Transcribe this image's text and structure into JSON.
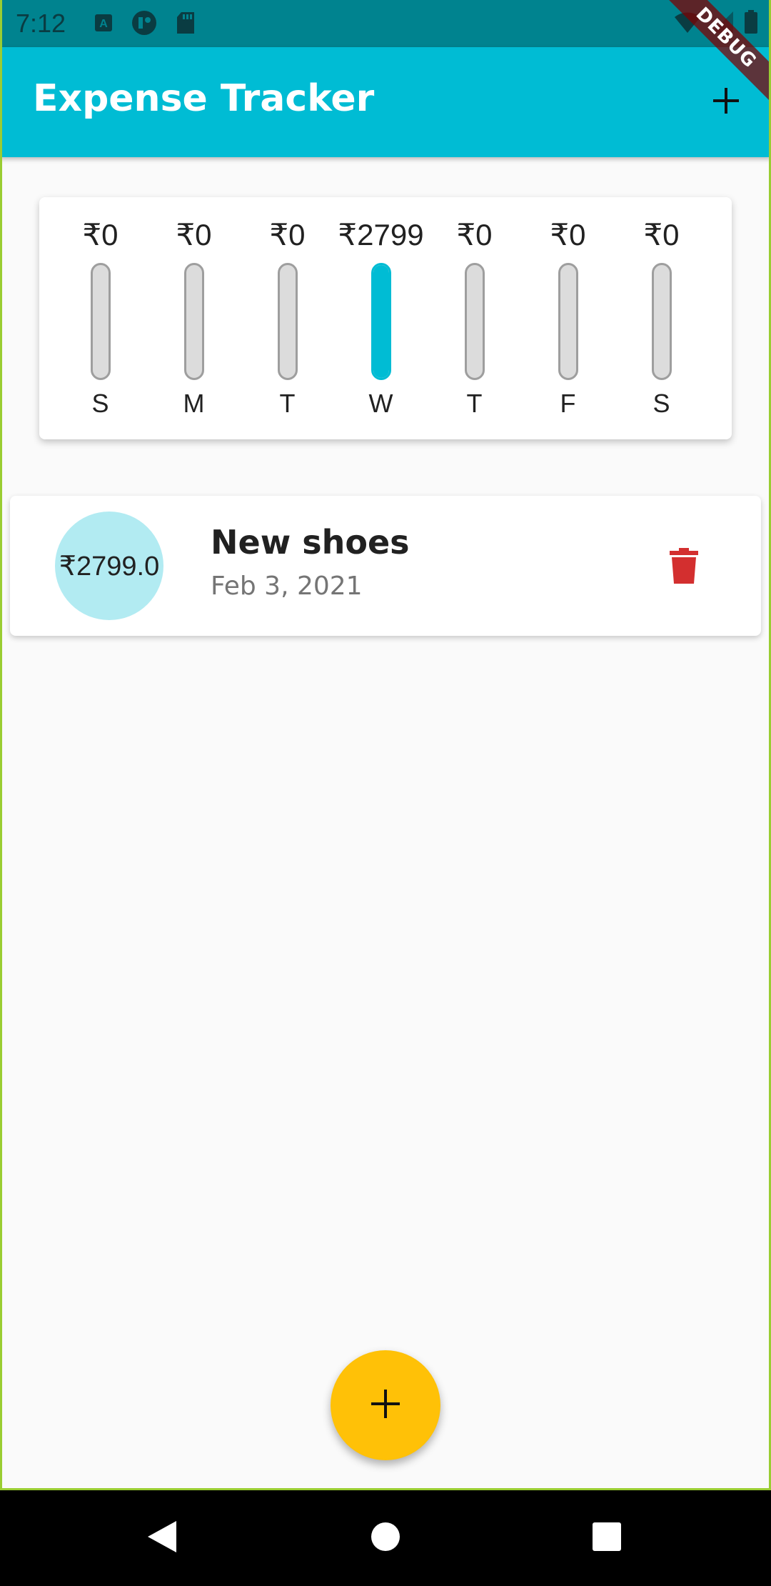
{
  "status_bar": {
    "time": "7:12",
    "left_icons": [
      "font-download-icon",
      "app-notification-icon",
      "sd-card-icon"
    ],
    "right_icons": [
      "wifi-icon",
      "signal-icon",
      "battery-icon"
    ]
  },
  "debug_banner": "DEBUG",
  "app_bar": {
    "title": "Expense Tracker",
    "action_icon": "add-icon",
    "color": "#00bcd4"
  },
  "chart": {
    "bars": [
      {
        "day": "S",
        "amount": "₹0",
        "fraction": 0
      },
      {
        "day": "M",
        "amount": "₹0",
        "fraction": 0
      },
      {
        "day": "T",
        "amount": "₹0",
        "fraction": 0
      },
      {
        "day": "W",
        "amount": "₹2799",
        "fraction": 1
      },
      {
        "day": "T",
        "amount": "₹0",
        "fraction": 0
      },
      {
        "day": "F",
        "amount": "₹0",
        "fraction": 0
      },
      {
        "day": "S",
        "amount": "₹0",
        "fraction": 0
      }
    ],
    "fill_color": "#00bcd4",
    "empty_color": "#dcdcdc"
  },
  "transactions": [
    {
      "amount": "₹2799.0",
      "title": "New shoes",
      "date": "Feb 3, 2021",
      "action_icon": "delete-icon",
      "action_color": "#d32f2f",
      "avatar_color": "#b2ebf2"
    }
  ],
  "fab": {
    "icon": "add-icon",
    "color": "#ffc107"
  },
  "nav_bar": {
    "buttons": [
      "back-icon",
      "home-icon",
      "recents-icon"
    ]
  }
}
